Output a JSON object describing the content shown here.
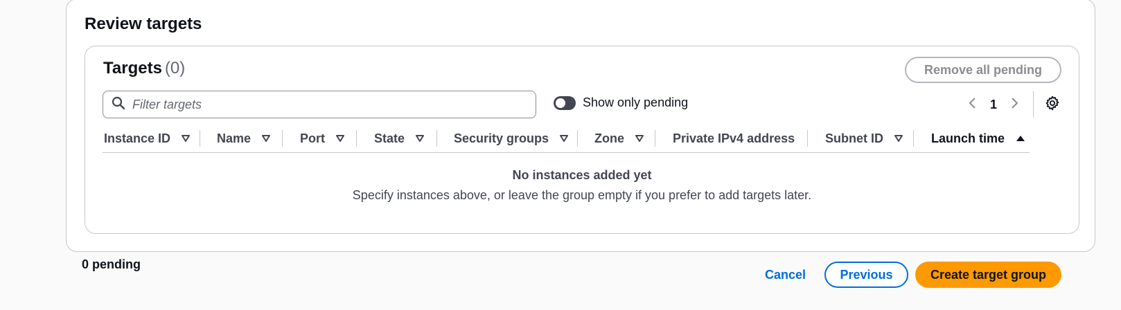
{
  "review": {
    "title": "Review targets"
  },
  "targets": {
    "title": "Targets",
    "count": "(0)",
    "remove_all_label": "Remove all pending",
    "filter": {
      "placeholder": "Filter targets",
      "value": ""
    },
    "toggle": {
      "label": "Show only pending",
      "enabled": false
    },
    "pagination": {
      "current_page": "1"
    },
    "columns": [
      {
        "label": "Instance ID",
        "sort": "filter"
      },
      {
        "label": "Name",
        "sort": "filter"
      },
      {
        "label": "Port",
        "sort": "filter"
      },
      {
        "label": "State",
        "sort": "filter"
      },
      {
        "label": "Security groups",
        "sort": "filter"
      },
      {
        "label": "Zone",
        "sort": "filter"
      },
      {
        "label": "Private IPv4 address",
        "sort": "none"
      },
      {
        "label": "Subnet ID",
        "sort": "filter"
      },
      {
        "label": "Launch time",
        "sort": "ascending"
      }
    ],
    "empty": {
      "title": "No instances added yet",
      "description": "Specify instances above, or leave the group empty if you prefer to add targets later."
    }
  },
  "footer": {
    "pending_label": "0 pending",
    "cancel_label": "Cancel",
    "previous_label": "Previous",
    "create_label": "Create target group"
  },
  "colors": {
    "primary_button": "#ff9900",
    "link": "#006ce0",
    "toggle_off": "#424650",
    "border": "#c6c6cd"
  }
}
